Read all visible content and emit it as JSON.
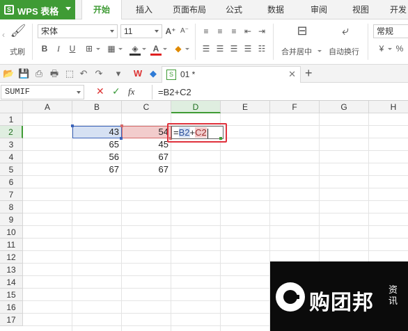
{
  "app": {
    "name": "WPS 表格",
    "logo_letter": "S"
  },
  "ribbon_tabs": [
    "开始",
    "插入",
    "页面布局",
    "公式",
    "数据",
    "审阅",
    "视图",
    "开发"
  ],
  "active_tab_index": 0,
  "ribbon": {
    "format_painter_label": "式刷",
    "font_name": "宋体",
    "font_size": "11",
    "merge_center_label": "合并居中",
    "wrap_text_label": "自动换行",
    "number_format": "常规",
    "currency_label": "¥",
    "percent_label": "%"
  },
  "document_tab": {
    "name": "01 *"
  },
  "formula_bar": {
    "name_box": "SUMIF",
    "formula": "=B2+C2"
  },
  "grid": {
    "columns": [
      "A",
      "B",
      "C",
      "D",
      "E",
      "F",
      "G",
      "H"
    ],
    "rows": [
      "1",
      "2",
      "3",
      "4",
      "5",
      "6",
      "7",
      "8",
      "9",
      "10",
      "11",
      "12",
      "13",
      "14",
      "15",
      "16",
      "17"
    ],
    "selected_column": "D",
    "selected_row": "2",
    "cells": {
      "B2": "43",
      "C2": "54",
      "B3": "65",
      "C3": "45",
      "B4": "56",
      "C4": "67",
      "B5": "67",
      "C5": "67"
    },
    "editing_cell": {
      "ref": "D2",
      "prefix": "=",
      "ref1": "B2",
      "op": "+",
      "ref2": "C2"
    }
  },
  "watermark": {
    "text": "购团邦",
    "sub": "资讯"
  },
  "colors": {
    "brand_green": "#3f9b35",
    "ref_b_blue": "#3b63b9",
    "ref_c_red": "#d56a6a",
    "annotation_red": "#e0313c"
  }
}
